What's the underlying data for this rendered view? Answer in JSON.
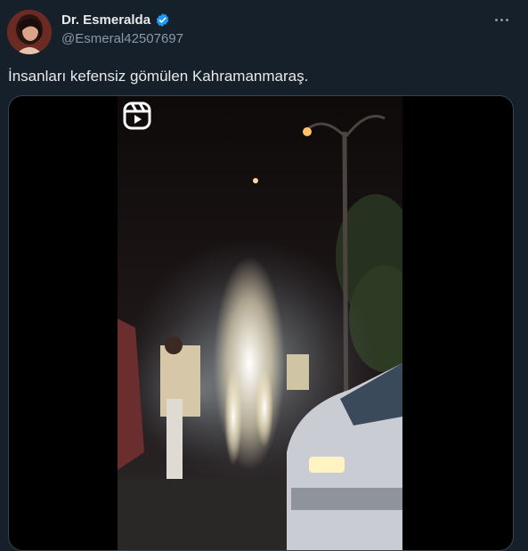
{
  "author": {
    "display_name": "Dr. Esmeralda",
    "handle": "@Esmeral42507697"
  },
  "tweet": {
    "text": "İnsanları kefensiz gömülen Kahramanmaraş."
  },
  "icons": {
    "verified": "verified-badge-icon",
    "more": "more-options-icon",
    "reels": "instagram-reels-icon"
  },
  "colors": {
    "background": "#15202b",
    "verified": "#1d9bf0",
    "secondary_text": "#8b98a5",
    "border": "#38444d"
  }
}
